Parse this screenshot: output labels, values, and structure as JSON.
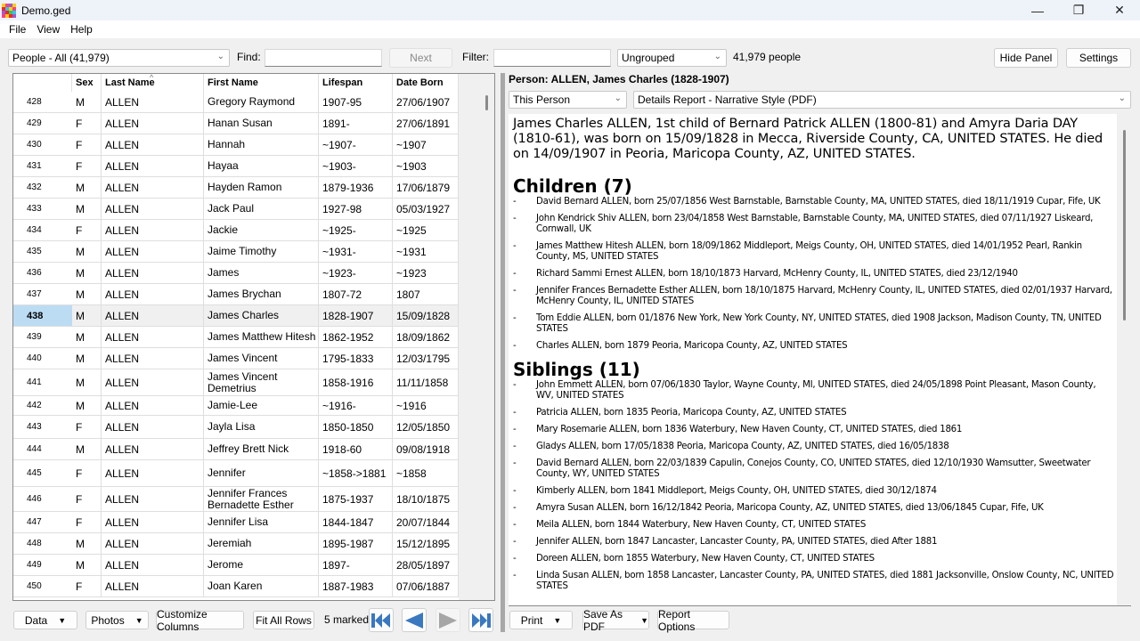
{
  "window": {
    "title": "Demo.ged",
    "controls": {
      "minimize": "—",
      "maximize": "❐",
      "close": "✕"
    }
  },
  "menu": {
    "items": [
      {
        "label": "File",
        "accel": "F"
      },
      {
        "label": "View",
        "accel": "V"
      },
      {
        "label": "Help",
        "accel": "H"
      }
    ]
  },
  "toolbar": {
    "people_select": "People - All (41,979)",
    "find_label": "Find:",
    "find_value": "",
    "next_label": "Next",
    "filter_label": "Filter:",
    "filter_value": "",
    "group_select": "Ungrouped",
    "people_count": "41,979 people",
    "hide_panel_label": "Hide Panel",
    "settings_label": "Settings"
  },
  "grid": {
    "columns": [
      "",
      "Sex",
      "Last Name",
      "First Name",
      "Lifespan",
      "Date Born"
    ],
    "sorted_column": "Last Name",
    "rows": [
      {
        "num": "428",
        "sex": "M",
        "last": "ALLEN",
        "first": "Gregory Raymond",
        "life": "1907-95",
        "born": "27/06/1907"
      },
      {
        "num": "429",
        "sex": "F",
        "last": "ALLEN",
        "first": "Hanan Susan",
        "life": "1891-",
        "born": "27/06/1891"
      },
      {
        "num": "430",
        "sex": "F",
        "last": "ALLEN",
        "first": "Hannah",
        "life": "~1907-",
        "born": "~1907"
      },
      {
        "num": "431",
        "sex": "F",
        "last": "ALLEN",
        "first": "Hayaa",
        "life": "~1903-",
        "born": "~1903"
      },
      {
        "num": "432",
        "sex": "M",
        "last": "ALLEN",
        "first": "Hayden Ramon",
        "life": "1879-1936",
        "born": "17/06/1879"
      },
      {
        "num": "433",
        "sex": "M",
        "last": "ALLEN",
        "first": "Jack Paul",
        "life": "1927-98",
        "born": "05/03/1927"
      },
      {
        "num": "434",
        "sex": "F",
        "last": "ALLEN",
        "first": "Jackie",
        "life": "~1925-",
        "born": "~1925"
      },
      {
        "num": "435",
        "sex": "M",
        "last": "ALLEN",
        "first": "Jaime Timothy",
        "life": "~1931-",
        "born": "~1931"
      },
      {
        "num": "436",
        "sex": "M",
        "last": "ALLEN",
        "first": "James",
        "life": "~1923-",
        "born": "~1923"
      },
      {
        "num": "437",
        "sex": "M",
        "last": "ALLEN",
        "first": "James Brychan",
        "life": "1807-72",
        "born": "1807"
      },
      {
        "num": "438",
        "sex": "M",
        "last": "ALLEN",
        "first": "James Charles",
        "life": "1828-1907",
        "born": "15/09/1828",
        "selected": true
      },
      {
        "num": "439",
        "sex": "M",
        "last": "ALLEN",
        "first": "James Matthew Hitesh",
        "life": "1862-1952",
        "born": "18/09/1862"
      },
      {
        "num": "440",
        "sex": "M",
        "last": "ALLEN",
        "first": "James Vincent",
        "life": "1795-1833",
        "born": "12/03/1795"
      },
      {
        "num": "441",
        "sex": "M",
        "last": "ALLEN",
        "first": "James Vincent Demetrius",
        "life": "1858-1916",
        "born": "11/11/1858"
      },
      {
        "num": "442",
        "sex": "M",
        "last": "ALLEN",
        "first": "Jamie-Lee",
        "life": "~1916-",
        "born": "~1916"
      },
      {
        "num": "443",
        "sex": "F",
        "last": "ALLEN",
        "first": "Jayla Lisa",
        "life": "1850-1850",
        "born": "12/05/1850"
      },
      {
        "num": "444",
        "sex": "M",
        "last": "ALLEN",
        "first": "Jeffrey Brett Nick",
        "life": "1918-60",
        "born": "09/08/1918"
      },
      {
        "num": "445",
        "sex": "F",
        "last": "ALLEN",
        "first": "Jennifer",
        "life": "~1858->1881",
        "born": "~1858"
      },
      {
        "num": "446",
        "sex": "F",
        "last": "ALLEN",
        "first": "Jennifer Frances Bernadette Esther",
        "life": "1875-1937",
        "born": "18/10/1875"
      },
      {
        "num": "447",
        "sex": "F",
        "last": "ALLEN",
        "first": "Jennifer Lisa",
        "life": "1844-1847",
        "born": "20/07/1844"
      },
      {
        "num": "448",
        "sex": "M",
        "last": "ALLEN",
        "first": "Jeremiah",
        "life": "1895-1987",
        "born": "15/12/1895"
      },
      {
        "num": "449",
        "sex": "M",
        "last": "ALLEN",
        "first": "Jerome",
        "life": "1897-",
        "born": "28/05/1897"
      },
      {
        "num": "450",
        "sex": "F",
        "last": "ALLEN",
        "first": "Joan Karen",
        "life": "1887-1983",
        "born": "07/06/1887"
      }
    ]
  },
  "footer_left": {
    "data_label": "Data",
    "photos_label": "Photos",
    "customize_label": "Customize Columns",
    "fit_rows_label": "Fit All Rows",
    "marked_text": "5 marked",
    "nav": {
      "first": "first-record",
      "prev": "previous-record",
      "next": "next-record",
      "last": "last-record"
    },
    "nav_color": "#3a78c0"
  },
  "panel": {
    "person_title": "Person: ALLEN, James Charles (1828-1907)",
    "scope_select": "This Person",
    "report_select": "Details Report - Narrative Style (PDF)",
    "report": {
      "intro": "James Charles ALLEN, 1st child of Bernard Patrick ALLEN (1800-81) and Amyra Daria DAY (1810-61), was born on 15/09/1828 in Mecca, Riverside County, CA, UNITED STATES. He died on 14/09/1907 in Peoria, Maricopa County, AZ, UNITED STATES.",
      "children_heading": "Children (7)",
      "children": [
        "David Bernard ALLEN, born 25/07/1856 West Barnstable, Barnstable County, MA, UNITED STATES, died 18/11/1919 Cupar, Fife, UK",
        "John Kendrick Shiv ALLEN, born 23/04/1858 West Barnstable, Barnstable County, MA, UNITED STATES, died 07/11/1927 Liskeard, Cornwall, UK",
        "James Matthew Hitesh ALLEN, born 18/09/1862 Middleport, Meigs County, OH, UNITED STATES, died 14/01/1952 Pearl, Rankin County, MS, UNITED STATES",
        "Richard Sammi Ernest ALLEN, born 18/10/1873 Harvard, McHenry County, IL, UNITED STATES, died 23/12/1940",
        "Jennifer Frances Bernadette Esther ALLEN, born 18/10/1875 Harvard, McHenry County, IL, UNITED STATES, died 02/01/1937 Harvard, McHenry County, IL, UNITED STATES",
        "Tom Eddie ALLEN, born 01/1876 New York, New York County, NY, UNITED STATES, died 1908 Jackson, Madison County, TN, UNITED STATES",
        "Charles ALLEN, born 1879 Peoria, Maricopa County, AZ, UNITED STATES"
      ],
      "siblings_heading": "Siblings (11)",
      "siblings": [
        "John Emmett ALLEN, born 07/06/1830 Taylor, Wayne County, MI, UNITED STATES, died 24/05/1898 Point Pleasant, Mason County, WV, UNITED STATES",
        "Patricia ALLEN, born 1835 Peoria, Maricopa County, AZ, UNITED STATES",
        "Mary Rosemarie ALLEN, born 1836 Waterbury, New Haven County, CT, UNITED STATES, died 1861",
        "Gladys ALLEN, born 17/05/1838 Peoria, Maricopa County, AZ, UNITED STATES, died 16/05/1838",
        "David Bernard ALLEN, born 22/03/1839 Capulin, Conejos County, CO, UNITED STATES, died 12/10/1930 Wamsutter, Sweetwater County, WY, UNITED STATES",
        "Kimberly ALLEN, born 1841 Middleport, Meigs County, OH, UNITED STATES, died 30/12/1874",
        "Amyra Susan ALLEN, born 16/12/1842 Peoria, Maricopa County, AZ, UNITED STATES, died 13/06/1845 Cupar, Fife, UK",
        "Meila ALLEN, born 1844 Waterbury, New Haven County, CT, UNITED STATES",
        "Jennifer ALLEN, born 1847 Lancaster, Lancaster County, PA, UNITED STATES, died After 1881",
        "Doreen ALLEN, born 1855 Waterbury, New Haven County, CT, UNITED STATES",
        "Linda Susan ALLEN, born 1858 Lancaster, Lancaster County, PA, UNITED STATES, died 1881 Jacksonville, Onslow County, NC, UNITED STATES"
      ],
      "bullet": "-"
    },
    "print_label": "Print",
    "save_pdf_label": "Save As PDF",
    "report_options_label": "Report Options"
  }
}
